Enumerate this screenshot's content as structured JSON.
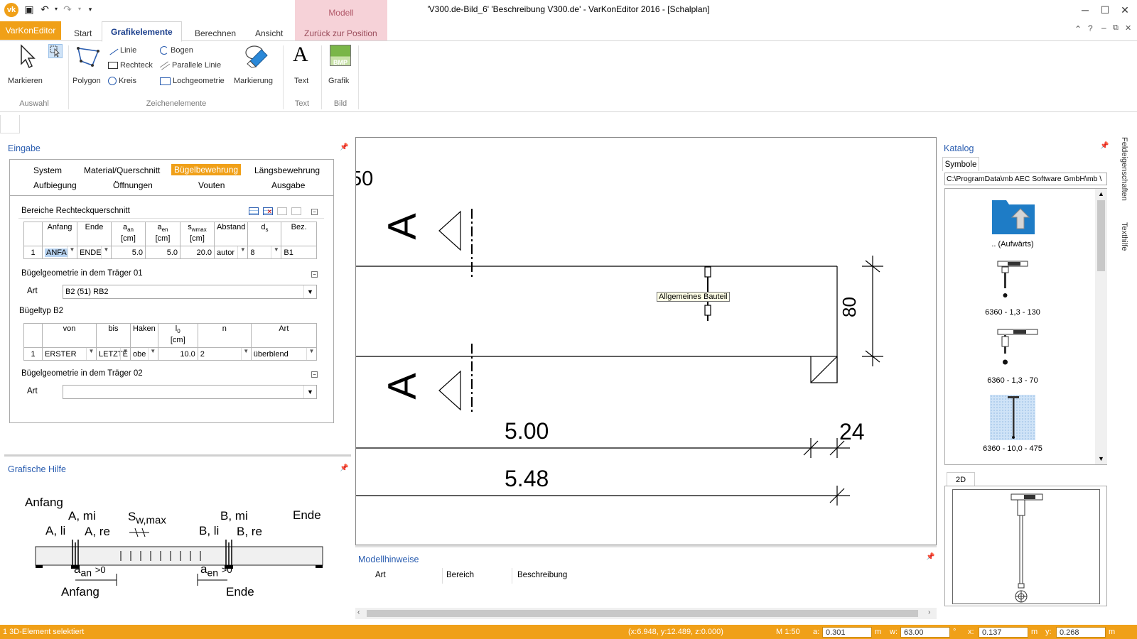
{
  "window": {
    "title": "'V300.de-Bild_6' 'Beschreibung V300.de' - VarKonEditor 2016 - [Schalplan]",
    "context_tab_header": "Modell"
  },
  "menu": {
    "app_button": "VarKonEditor",
    "tabs": [
      "Start",
      "Grafikelemente",
      "Berechnen",
      "Ansicht"
    ],
    "context_tab": "Zurück zur Position"
  },
  "ribbon": {
    "markieren": "Markieren",
    "polygon": "Polygon",
    "linie": "Linie",
    "rechteck": "Rechteck",
    "kreis": "Kreis",
    "bogen": "Bogen",
    "parallele_linie": "Parallele Linie",
    "lochgeometrie": "Lochgeometrie",
    "markierung": "Markierung",
    "text": "Text",
    "grafik": "Grafik",
    "bmp": "BMP",
    "groups": {
      "auswahl": "Auswahl",
      "zeichenelemente": "Zeichenelemente",
      "text": "Text",
      "bild": "Bild"
    }
  },
  "eingabe": {
    "title": "Eingabe",
    "tabs_row1": [
      "System",
      "Material/Querschnitt",
      "Bügelbewehrung",
      "Längsbewehrung"
    ],
    "tabs_row2": [
      "Aufbiegung",
      "Öffnungen",
      "Vouten",
      "Ausgabe"
    ],
    "section1": {
      "title": "Bereiche Rechteckquerschnitt",
      "headers": [
        "Anfang",
        "Ende",
        "a an [cm]",
        "a en [cm]",
        "s wmax [cm]",
        "Abstand",
        "d s",
        "Bez."
      ],
      "row": {
        "nr": "1",
        "anfang": "ANFA",
        "ende": "ENDE",
        "aan": "5.0",
        "aen": "5.0",
        "swmax": "20.0",
        "abstand": "autor",
        "ds": "8",
        "bez": "B1"
      }
    },
    "section2": {
      "title": "Bügelgeometrie in dem Träger 01",
      "art_label": "Art",
      "art_value": "B2 (51) RB2"
    },
    "section3": {
      "title": "Bügeltyp B2",
      "headers": [
        "von",
        "bis",
        "Haken",
        "l0 [cm]",
        "n",
        "Art"
      ],
      "row": {
        "nr": "1",
        "von": "ERSTER",
        "bis": "LETZTE",
        "haken": "obe",
        "l0": "10.0",
        "n": "2",
        "art": "überblend"
      }
    },
    "section4": {
      "title": "Bügelgeometrie in dem Träger 02",
      "art_label": "Art",
      "art_value": ""
    }
  },
  "grafische_hilfe": {
    "title": "Grafische Hilfe",
    "labels": {
      "anfang": "Anfang",
      "a_mi": "A, mi",
      "a_li": "A, li",
      "a_re": "A, re",
      "swmax": "S",
      "swmax_sub": "w,max",
      "b_mi": "B, mi",
      "b_li": "B, li",
      "b_re": "B, re",
      "ende": "Ende",
      "aan": "a",
      "aan_sub": "an",
      "aan_val": ">0",
      "aen": "a",
      "aen_sub": "en",
      "aen_val": ">0",
      "anfang2": "Anfang",
      "ende2": "Ende"
    }
  },
  "drawing": {
    "dim_top": "50",
    "section_label": "A",
    "height_dim": "80",
    "length1": "5.00",
    "length2": "5.48",
    "end_dim": "24",
    "tooltip": "Allgemeines Bauteil"
  },
  "modellhinweise": {
    "title": "Modellhinweise",
    "columns": [
      "Art",
      "Bereich",
      "Beschreibung"
    ]
  },
  "katalog": {
    "title": "Katalog",
    "tab": "Symbole",
    "path": "C:\\ProgramData\\mb AEC Software GmbH\\mb \\",
    "items": [
      ".. (Aufwärts)",
      "6360 - 1,3 - 130",
      "6360 - 1,3 - 70",
      "6360 - 10,0 - 475"
    ],
    "preview_tab": "2D"
  },
  "side_tabs": [
    "Feldeigenschaften",
    "Texthilfe"
  ],
  "status": {
    "message": "1 3D-Element selektiert",
    "coords": "(x:6.948, y:12.489, z:0.000)",
    "scale": "M 1:50",
    "a_label": "a:",
    "a_value": "0.301",
    "a_unit": "m",
    "w_label": "w:",
    "w_value": "63.00",
    "w_unit": "°",
    "x_label": "x:",
    "x_value": "0.137",
    "x_unit": "m",
    "y_label": "y:",
    "y_value": "0.268",
    "y_unit": "m"
  },
  "colors": {
    "accent": "#f0a018",
    "link_blue": "#2a5db0",
    "context_pink": "#f6d2d8"
  }
}
